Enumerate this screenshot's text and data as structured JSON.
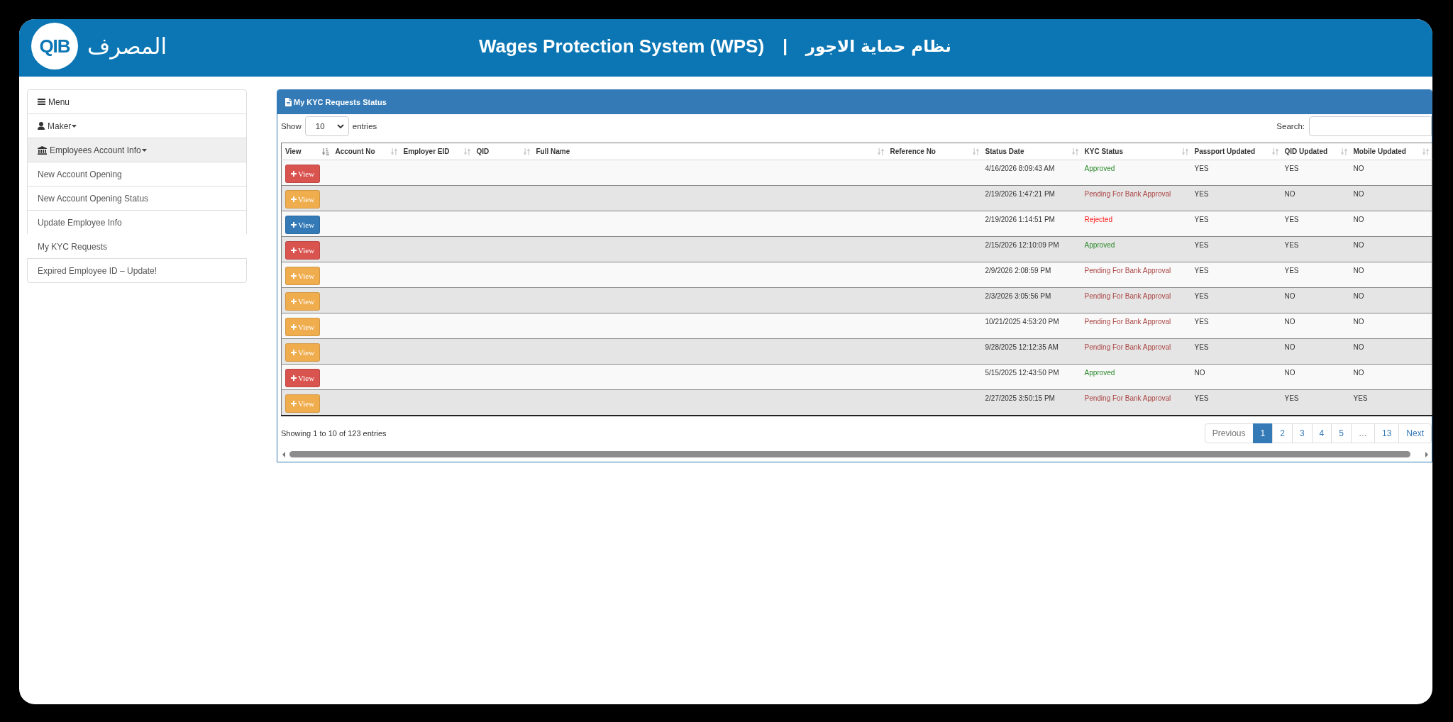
{
  "header": {
    "logo": {
      "mark": "QIB",
      "wordmark": "المصرف"
    },
    "title": "Wages Protection System (WPS)",
    "separator": "|",
    "title_arabic": "نظام حماية الاجور"
  },
  "sidebar": {
    "items": [
      {
        "kind": "heading",
        "label": "Menu"
      },
      {
        "kind": "dropdown",
        "label": "Maker",
        "expanded": false
      },
      {
        "kind": "dropdown",
        "label": "Employees Account Info",
        "expanded": true,
        "children": [
          {
            "label": "New Account Opening",
            "selected": false
          },
          {
            "label": "New Account Opening Status",
            "selected": false
          },
          {
            "label": "Update Employee Info",
            "selected": false
          },
          {
            "label": "My KYC Requests",
            "selected": true
          },
          {
            "label": "Expired Employee ID – Update!",
            "selected": false
          }
        ]
      }
    ]
  },
  "panel": {
    "title": "My KYC Requests Status",
    "length_menu": {
      "label_before": "Show",
      "value": "10",
      "label_after": "entries"
    },
    "search": {
      "label": "Search:"
    },
    "table": {
      "columns": [
        {
          "label": "View",
          "sorted": true
        },
        {
          "label": "Account No",
          "sorted": false
        },
        {
          "label": "Employer EID",
          "sorted": false
        },
        {
          "label": "QID",
          "sorted": false
        },
        {
          "label": "Full Name",
          "sorted": false
        },
        {
          "label": "Reference No",
          "sorted": false
        },
        {
          "label": "Status Date",
          "sorted": false
        },
        {
          "label": "KYC Status",
          "sorted": false
        },
        {
          "label": "Passport Updated",
          "sorted": false
        },
        {
          "label": "QID Updated",
          "sorted": false
        },
        {
          "label": "Mobile Updated",
          "sorted": false
        }
      ],
      "rows": [
        {
          "button": {
            "label": "View",
            "color": "#d9534f"
          },
          "status_date": "4/16/2026 8:09:43 AM",
          "kyc_status": {
            "text": "Approved",
            "color": "#2b8a2b"
          },
          "passport_updated": "YES",
          "qid_updated": "YES",
          "mobile_updated": "NO"
        },
        {
          "button": {
            "label": "View",
            "color": "#f0ad4e"
          },
          "status_date": "2/19/2026 1:47:21 PM",
          "kyc_status": {
            "text": "Pending For Bank Approval",
            "color": "#a94442"
          },
          "passport_updated": "YES",
          "qid_updated": "NO",
          "mobile_updated": "NO"
        },
        {
          "button": {
            "label": "View",
            "color": "#337ab7"
          },
          "status_date": "2/19/2026 1:14:51 PM",
          "kyc_status": {
            "text": "Rejected",
            "color": "#ff2020"
          },
          "passport_updated": "YES",
          "qid_updated": "YES",
          "mobile_updated": "NO"
        },
        {
          "button": {
            "label": "View",
            "color": "#d9534f"
          },
          "status_date": "2/15/2026 12:10:09 PM",
          "kyc_status": {
            "text": "Approved",
            "color": "#2b8a2b"
          },
          "passport_updated": "YES",
          "qid_updated": "YES",
          "mobile_updated": "NO"
        },
        {
          "button": {
            "label": "View",
            "color": "#f0ad4e"
          },
          "status_date": "2/9/2026 2:08:59 PM",
          "kyc_status": {
            "text": "Pending For Bank Approval",
            "color": "#a94442"
          },
          "passport_updated": "YES",
          "qid_updated": "YES",
          "mobile_updated": "NO"
        },
        {
          "button": {
            "label": "View",
            "color": "#f0ad4e"
          },
          "status_date": "2/3/2026 3:05:56 PM",
          "kyc_status": {
            "text": "Pending For Bank Approval",
            "color": "#a94442"
          },
          "passport_updated": "YES",
          "qid_updated": "NO",
          "mobile_updated": "NO"
        },
        {
          "button": {
            "label": "View",
            "color": "#f0ad4e"
          },
          "status_date": "10/21/2025 4:53:20 PM",
          "kyc_status": {
            "text": "Pending For Bank Approval",
            "color": "#a94442"
          },
          "passport_updated": "YES",
          "qid_updated": "NO",
          "mobile_updated": "NO"
        },
        {
          "button": {
            "label": "View",
            "color": "#f0ad4e"
          },
          "status_date": "9/28/2025 12:12:35 AM",
          "kyc_status": {
            "text": "Pending For Bank Approval",
            "color": "#a94442"
          },
          "passport_updated": "YES",
          "qid_updated": "NO",
          "mobile_updated": "NO"
        },
        {
          "button": {
            "label": "View",
            "color": "#d9534f"
          },
          "status_date": "5/15/2025 12:43:50 PM",
          "kyc_status": {
            "text": "Approved",
            "color": "#2b8a2b"
          },
          "passport_updated": "NO",
          "qid_updated": "NO",
          "mobile_updated": "NO"
        },
        {
          "button": {
            "label": "View",
            "color": "#f0ad4e"
          },
          "status_date": "2/27/2025 3:50:15 PM",
          "kyc_status": {
            "text": "Pending For Bank Approval",
            "color": "#a94442"
          },
          "passport_updated": "YES",
          "qid_updated": "YES",
          "mobile_updated": "YES"
        }
      ]
    },
    "info": "Showing 1 to 10 of 123 entries",
    "pagination": [
      {
        "label": "Previous",
        "selected": false,
        "disabled": true
      },
      {
        "label": "1",
        "selected": true,
        "disabled": false
      },
      {
        "label": "2",
        "selected": false,
        "disabled": false
      },
      {
        "label": "3",
        "selected": false,
        "disabled": false
      },
      {
        "label": "4",
        "selected": false,
        "disabled": false
      },
      {
        "label": "5",
        "selected": false,
        "disabled": false
      },
      {
        "label": "…",
        "selected": false,
        "disabled": true
      },
      {
        "label": "13",
        "selected": false,
        "disabled": false
      },
      {
        "label": "Next",
        "selected": false,
        "disabled": false
      }
    ]
  }
}
